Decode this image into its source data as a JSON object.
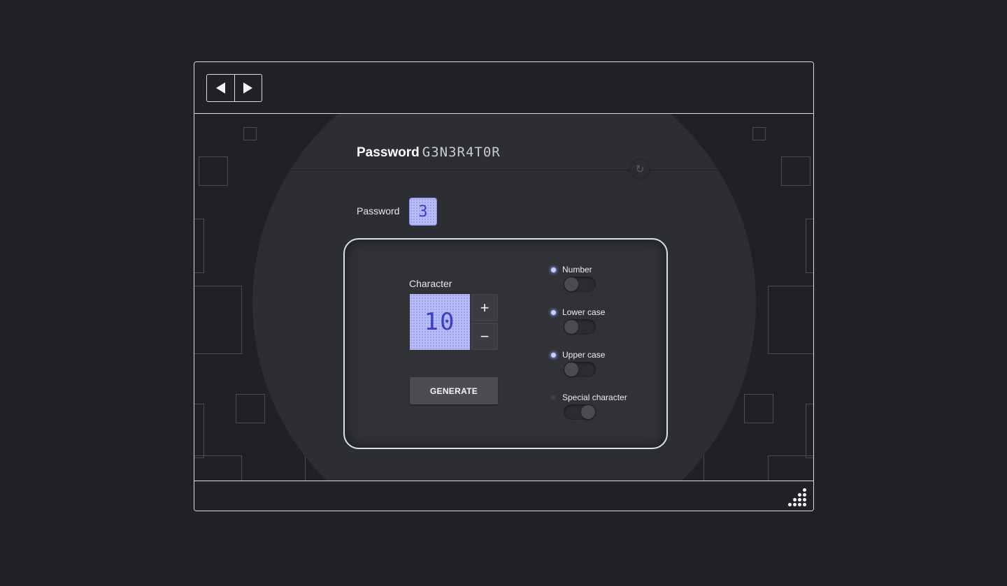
{
  "app": {
    "title_bold": "Password",
    "title_mono": "G3N3R4T0R"
  },
  "nav": {
    "back_icon": "triangle-left-icon",
    "forward_icon": "triangle-right-icon"
  },
  "password": {
    "label": "Password",
    "value": "3"
  },
  "character": {
    "label": "Character",
    "value": "10",
    "increment_label": "+",
    "decrement_label": "−"
  },
  "generate": {
    "label": "GENERATE"
  },
  "options": [
    {
      "label": "Number",
      "indicator_on": true,
      "toggle_on": false
    },
    {
      "label": "Lower case",
      "indicator_on": true,
      "toggle_on": false
    },
    {
      "label": "Upper case",
      "indicator_on": true,
      "toggle_on": false
    },
    {
      "label": "Special character",
      "indicator_on": false,
      "toggle_on": true
    }
  ],
  "icons": {
    "refresh": "refresh-icon",
    "resize": "resize-grip-icon"
  },
  "colors": {
    "background": "#1f2126",
    "panel": "#303236",
    "lcd_fill": "#b8bcf6",
    "lcd_text": "#3b3fc4",
    "accent_glow": "#8f98ff",
    "border": "#d9dce2"
  }
}
